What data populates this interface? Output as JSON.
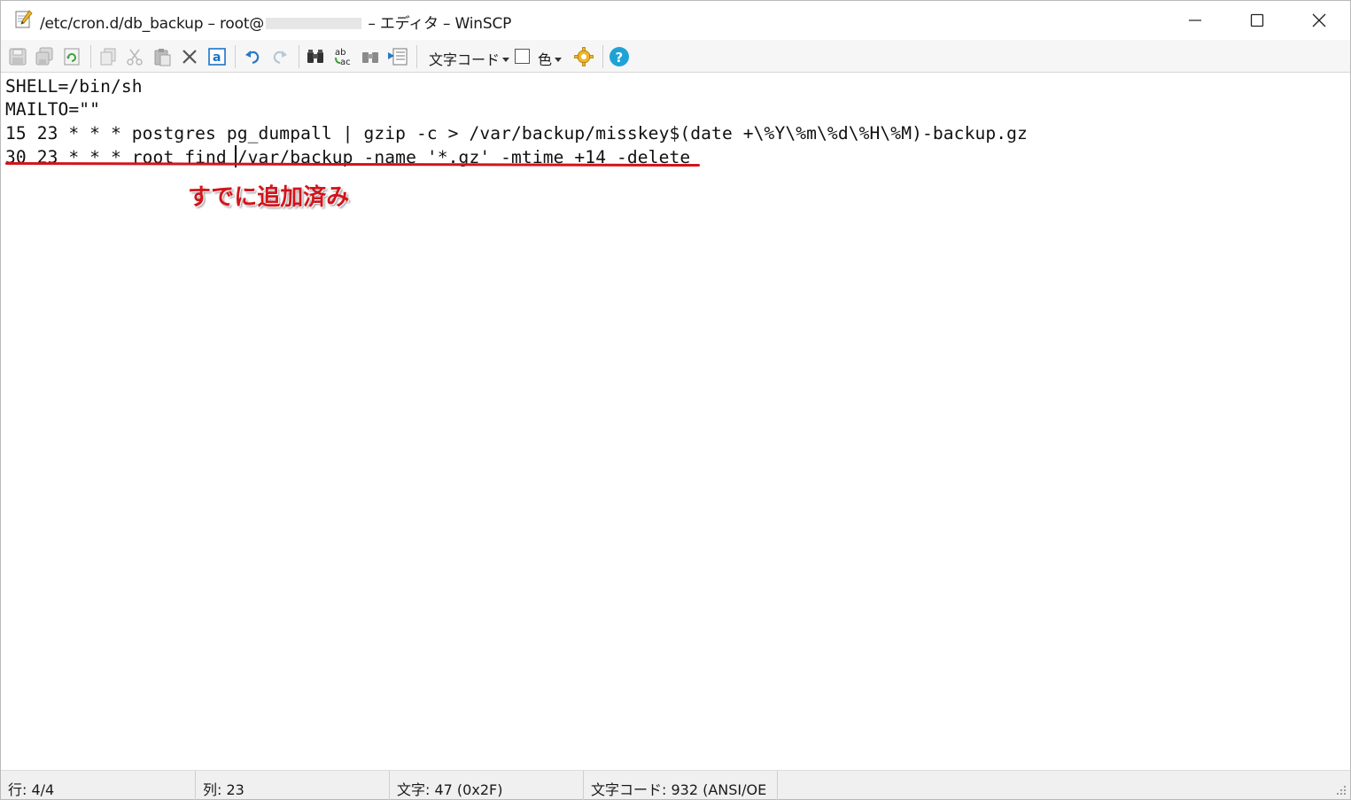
{
  "window": {
    "title_prefix": "/etc/cron.d/db_backup – root@",
    "title_suffix": "– エディタ – WinSCP"
  },
  "toolbar": {
    "encoding_label": "文字コード",
    "color_label": "色",
    "icons": [
      "save-icon",
      "save-all-icon",
      "reload-icon",
      "copy-icon",
      "cut-icon",
      "paste-icon",
      "delete-icon",
      "select-all-icon",
      "undo-icon",
      "redo-icon",
      "find-icon",
      "replace-icon",
      "find-next-icon",
      "goto-line-icon",
      "color-swatch",
      "settings-icon",
      "help-icon"
    ]
  },
  "editor": {
    "lines": [
      "SHELL=/bin/sh",
      "MAILTO=\"\"",
      "15 23 * * * postgres pg_dumpall | gzip -c > /var/backup/misskey$(date +\\%Y\\%m\\%d\\%H\\%M)-backup.gz",
      "30 23 * * * root find /var/backup -name '*.gz' -mtime +14 -delete"
    ],
    "annotation": "すでに追加済み",
    "annotation_color": "#d3141b"
  },
  "status": {
    "line": "行: 4/4",
    "column": "列: 23",
    "char": "文字: 47 (0x2F)",
    "encoding": "文字コード: 932 (ANSI/OE"
  },
  "colors": {
    "accent_blue": "#1a73c8",
    "annotation_red": "#d3141b"
  }
}
